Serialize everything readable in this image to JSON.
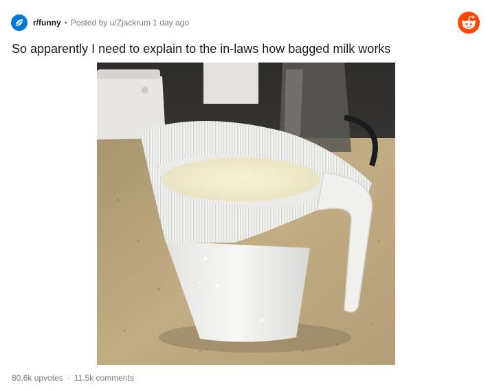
{
  "post": {
    "subreddit": "r/funny",
    "separator": "•",
    "posted_by_prefix": "Posted by",
    "author": "u/Zjackrum",
    "time": "1 day ago",
    "title": "So apparently I need to explain to the in-laws how bagged milk works"
  },
  "footer": {
    "upvotes": "80.6k upvotes",
    "separator": "·",
    "comments": "11.5k comments"
  },
  "icons": {
    "subreddit_icon": "subreddit-leaf-icon",
    "brand_icon": "reddit-snoo-icon"
  },
  "colors": {
    "subreddit_icon_bg": "#0079d3",
    "brand": "#ff4500",
    "meta_text": "#787c7e"
  }
}
